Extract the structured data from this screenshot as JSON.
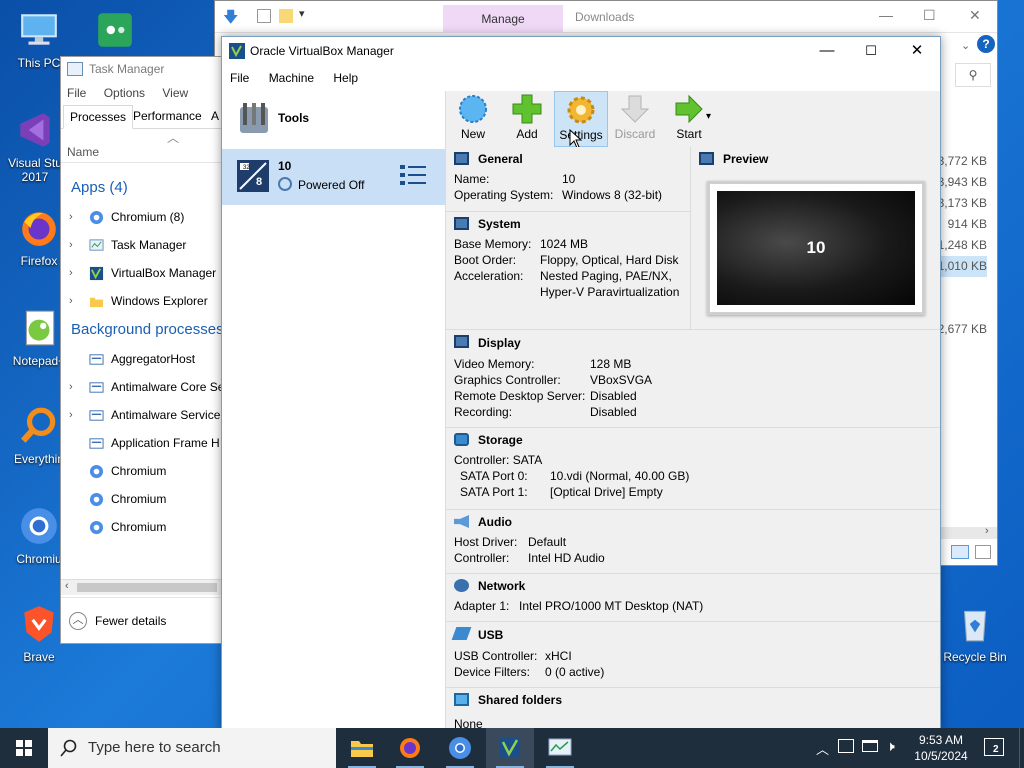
{
  "desktop": {
    "icons": [
      {
        "label": "This PC",
        "icon": "computer-icon"
      },
      {
        "label": "",
        "icon": "game-controller-icon"
      },
      {
        "label": "Visual Studio 2017",
        "icon": "visual-studio-icon"
      },
      {
        "label": "Firefox",
        "icon": "firefox-icon"
      },
      {
        "label": "Notepad++",
        "icon": "notepad-plus-icon"
      },
      {
        "label": "Everything",
        "icon": "everything-search-icon"
      },
      {
        "label": "Chromium",
        "icon": "chromium-icon"
      },
      {
        "label": "Brave",
        "icon": "brave-icon"
      },
      {
        "label": "Recycle Bin",
        "icon": "recycle-bin-icon"
      }
    ],
    "visible_labels": {
      "this_pc": "This PC",
      "vs": "Visual Stu",
      "vs2": "2017",
      "firefox": "Firefox",
      "notepad": "Notepad+",
      "everything": "Everythin",
      "chromium": "Chromiu",
      "brave": "Brave",
      "recycle": "Recycle Bin"
    }
  },
  "explorer": {
    "manage_tab": "Manage",
    "downloads_tab": "Downloads",
    "sizes": [
      "3,772 KB",
      "3,943 KB",
      "3,173 KB",
      "914 KB",
      "1,248 KB",
      "1,010 KB",
      "",
      "",
      "2,677 KB"
    ]
  },
  "taskmgr": {
    "title": "Task Manager",
    "menu": [
      "File",
      "Options",
      "View"
    ],
    "tabs": [
      "Processes",
      "Performance",
      "A"
    ],
    "name_header": "Name",
    "apps_header": "Apps (4)",
    "apps": [
      {
        "name": "Chromium (8)",
        "icon": "chromium-icon"
      },
      {
        "name": "Task Manager",
        "icon": "task-manager-icon"
      },
      {
        "name": "VirtualBox Manager",
        "icon": "virtualbox-icon"
      },
      {
        "name": "Windows Explorer",
        "icon": "folder-icon"
      }
    ],
    "bg_header": "Background processes",
    "bg": [
      {
        "name": "AggregatorHost",
        "chev": false
      },
      {
        "name": "Antimalware Core Se",
        "chev": true
      },
      {
        "name": "Antimalware Service",
        "chev": true
      },
      {
        "name": "Application Frame H",
        "chev": false
      },
      {
        "name": "Chromium",
        "chev": false
      },
      {
        "name": "Chromium",
        "chev": false
      },
      {
        "name": "Chromium",
        "chev": false
      }
    ],
    "fewer_details": "Fewer details"
  },
  "vbox": {
    "title": "Oracle VirtualBox Manager",
    "menu": [
      "File",
      "Machine",
      "Help"
    ],
    "tools_label": "Tools",
    "vm": {
      "name": "10",
      "state": "Powered Off",
      "badge": "8"
    },
    "toolbar": {
      "new": "New",
      "add": "Add",
      "settings": "Settings",
      "discard": "Discard",
      "start": "Start"
    },
    "general": {
      "title": "General",
      "name_k": "Name:",
      "name_v": "10",
      "os_k": "Operating System:",
      "os_v": "Windows 8 (32-bit)"
    },
    "system": {
      "title": "System",
      "mem_k": "Base Memory:",
      "mem_v": "1024 MB",
      "boot_k": "Boot Order:",
      "boot_v": "Floppy, Optical, Hard Disk",
      "accel_k": "Acceleration:",
      "accel_v1": "Nested Paging, PAE/NX,",
      "accel_v2": "Hyper-V Paravirtualization"
    },
    "preview": {
      "title": "Preview",
      "screen_text": "10"
    },
    "display": {
      "title": "Display",
      "vmem_k": "Video Memory:",
      "vmem_v": "128 MB",
      "gc_k": "Graphics Controller:",
      "gc_v": "VBoxSVGA",
      "rds_k": "Remote Desktop Server:",
      "rds_v": "Disabled",
      "rec_k": "Recording:",
      "rec_v": "Disabled"
    },
    "storage": {
      "title": "Storage",
      "ctrl": "Controller: SATA",
      "p0_k": "SATA Port 0:",
      "p0_v": "10.vdi (Normal, 40.00 GB)",
      "p1_k": "SATA Port 1:",
      "p1_v": "[Optical Drive] Empty"
    },
    "audio": {
      "title": "Audio",
      "host_k": "Host Driver:",
      "host_v": "Default",
      "ctrl_k": "Controller:",
      "ctrl_v": "Intel HD Audio"
    },
    "network": {
      "title": "Network",
      "a1_k": "Adapter 1:",
      "a1_v": "Intel PRO/1000 MT Desktop (NAT)"
    },
    "usb": {
      "title": "USB",
      "ctrl_k": "USB Controller:",
      "ctrl_v": "xHCI",
      "filt_k": "Device Filters:",
      "filt_v": "0 (0 active)"
    },
    "shared": {
      "title": "Shared folders",
      "v": "None"
    }
  },
  "taskbar": {
    "search_placeholder": "Type here to search",
    "time": "9:53 AM",
    "date": "10/5/2024",
    "notif_count": "2"
  }
}
